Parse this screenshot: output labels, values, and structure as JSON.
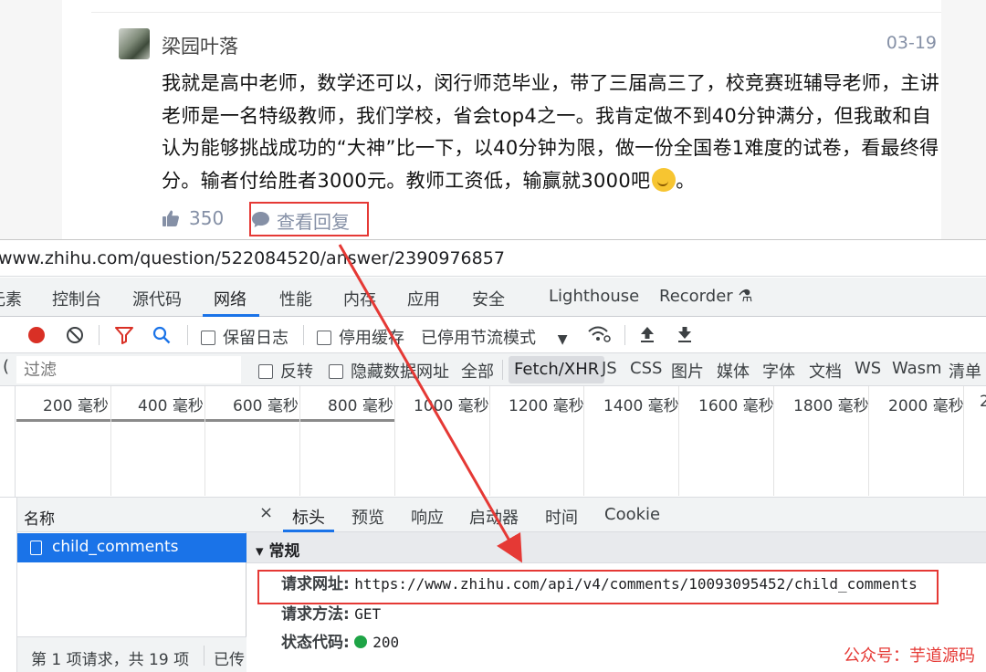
{
  "comment": {
    "author": "梁园叶落",
    "date": "03-19",
    "text": "我就是高中老师，数学还可以，闵行师范毕业，带了三届高三了，校竞赛班辅导老师，主讲老师是一名特级教师，我们学校，省会top4之一。我肯定做不到40分钟满分，但我敢和自认为能够挑战成功的“大神”比一下，以40分钟为限，做一份全国卷1难度的试卷，看最终得分。输者付给胜者3000元。教师工资低，输赢就3000吧",
    "likes": "350",
    "reply_label": "查看回复",
    "like_icon": "thumbs-up-icon",
    "reply_icon": "speech-bubble-icon",
    "emoji": "thinking-face-emoji"
  },
  "devtools": {
    "url": "www.zhihu.com/question/522084520/answer/2390976857",
    "panel_tabs": [
      "元素",
      "控制台",
      "源代码",
      "网络",
      "性能",
      "内存",
      "应用",
      "安全",
      "Lighthouse",
      "Recorder"
    ],
    "active_panel": "网络",
    "toolbar": {
      "preserve_log": "保留日志",
      "disable_cache": "停用缓存",
      "throttling": "已停用节流模式"
    },
    "filter": {
      "placeholder": "过滤",
      "invert": "反转",
      "hide_data_urls": "隐藏数据网址",
      "types": [
        "全部",
        "Fetch/XHR",
        "JS",
        "CSS",
        "图片",
        "媒体",
        "字体",
        "文档",
        "WS",
        "Wasm",
        "清单"
      ],
      "selected_type": "Fetch/XHR"
    },
    "timeline_ticks": [
      "200 毫秒",
      "400 毫秒",
      "600 毫秒",
      "800 毫秒",
      "1000 毫秒",
      "1200 毫秒",
      "1400 毫秒",
      "1600 毫秒",
      "1800 毫秒",
      "2000 毫秒",
      "2"
    ],
    "requests": {
      "header": "名称",
      "items": [
        "child_comments"
      ],
      "status": "第 1 项请求，共 19 项",
      "status2": "已传"
    },
    "detail": {
      "close": "×",
      "tabs": [
        "标头",
        "预览",
        "响应",
        "启动器",
        "时间",
        "Cookie"
      ],
      "active_tab": "标头",
      "section": "▾ 常规",
      "fields": [
        {
          "key": "请求网址:",
          "value": "https://www.zhihu.com/api/v4/comments/10093095452/child_comments"
        },
        {
          "key": "请求方法:",
          "value": "GET"
        },
        {
          "key": "状态代码:",
          "value": "200"
        }
      ]
    }
  },
  "watermark": "公众号：芋道源码",
  "colors": {
    "annotation_red": "#e53935",
    "devtools_blue": "#1a73e8",
    "status_green": "#1ea446"
  }
}
